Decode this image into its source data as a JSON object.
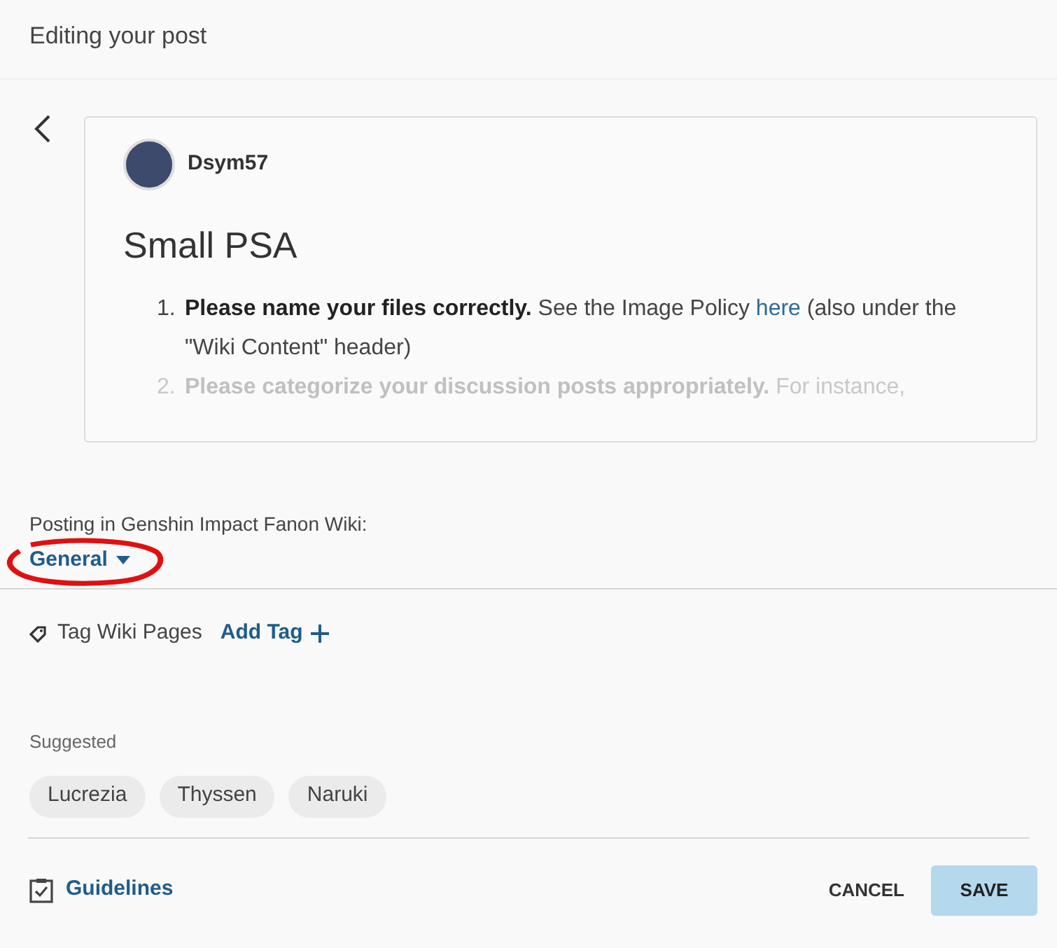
{
  "header": {
    "title": "Editing your post"
  },
  "post": {
    "author": "Dsym57",
    "title": "Small PSA",
    "items": [
      {
        "number": "1.",
        "lead": "Please name your files correctly.",
        "text_before": " See the Image Policy ",
        "link": "here",
        "text_after": " (also under the \"Wiki Content\" header)"
      },
      {
        "number": "2.",
        "lead": "Please categorize your discussion posts appropriately.",
        "text_before": " For instance,"
      }
    ]
  },
  "posting": {
    "label": "Posting in Genshin Impact Fanon Wiki:",
    "category": "General"
  },
  "tags": {
    "label": "Tag Wiki Pages",
    "add": "Add Tag",
    "suggested_label": "Suggested",
    "suggested": [
      "Lucrezia",
      "Thyssen",
      "Naruki"
    ]
  },
  "footer": {
    "guidelines": "Guidelines",
    "cancel": "CANCEL",
    "save": "SAVE"
  }
}
